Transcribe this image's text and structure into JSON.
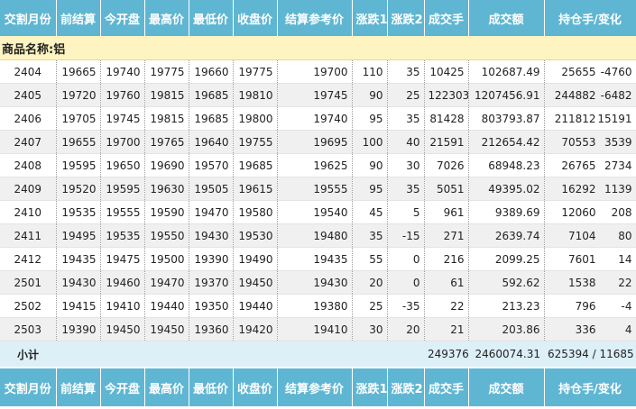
{
  "columns": [
    "交割月份",
    "前结算",
    "今开盘",
    "最高价",
    "最低价",
    "收盘价",
    "结算参考价",
    "涨跌1",
    "涨跌2",
    "成交手",
    "成交额",
    "持仓手/变化"
  ],
  "group_title": "商品名称:铝",
  "rows": [
    [
      "2404",
      "19665",
      "19740",
      "19775",
      "19660",
      "19775",
      "19700",
      "110",
      "35",
      "10425",
      "102687.49",
      "25655",
      "-4760"
    ],
    [
      "2405",
      "19720",
      "19760",
      "19815",
      "19685",
      "19810",
      "19745",
      "90",
      "25",
      "122303",
      "1207456.91",
      "244882",
      "-6482"
    ],
    [
      "2406",
      "19705",
      "19745",
      "19815",
      "19685",
      "19800",
      "19740",
      "95",
      "35",
      "81428",
      "803793.87",
      "211812",
      "15191"
    ],
    [
      "2407",
      "19655",
      "19700",
      "19765",
      "19640",
      "19755",
      "19695",
      "100",
      "40",
      "21591",
      "212654.42",
      "70553",
      "3539"
    ],
    [
      "2408",
      "19595",
      "19650",
      "19690",
      "19570",
      "19685",
      "19625",
      "90",
      "30",
      "7026",
      "68948.23",
      "26765",
      "2734"
    ],
    [
      "2409",
      "19520",
      "19595",
      "19630",
      "19505",
      "19615",
      "19555",
      "95",
      "35",
      "5051",
      "49395.02",
      "16292",
      "1139"
    ],
    [
      "2410",
      "19535",
      "19555",
      "19590",
      "19470",
      "19580",
      "19540",
      "45",
      "5",
      "961",
      "9389.69",
      "12060",
      "208"
    ],
    [
      "2411",
      "19495",
      "19535",
      "19550",
      "19430",
      "19530",
      "19480",
      "35",
      "-15",
      "271",
      "2639.74",
      "7104",
      "80"
    ],
    [
      "2412",
      "19435",
      "19475",
      "19500",
      "19390",
      "19490",
      "19435",
      "55",
      "0",
      "216",
      "2099.25",
      "7601",
      "14"
    ],
    [
      "2501",
      "19430",
      "19460",
      "19470",
      "19370",
      "19450",
      "19430",
      "20",
      "0",
      "61",
      "592.62",
      "1538",
      "22"
    ],
    [
      "2502",
      "19415",
      "19410",
      "19440",
      "19350",
      "19440",
      "19380",
      "25",
      "-35",
      "22",
      "213.23",
      "796",
      "-4"
    ],
    [
      "2503",
      "19390",
      "19450",
      "19450",
      "19360",
      "19420",
      "19410",
      "30",
      "20",
      "21",
      "203.86",
      "336",
      "4"
    ]
  ],
  "subtotal": {
    "label": "小计",
    "volume": "249376",
    "turnover": "2460074.31",
    "open_interest": "625394 / 11685"
  }
}
